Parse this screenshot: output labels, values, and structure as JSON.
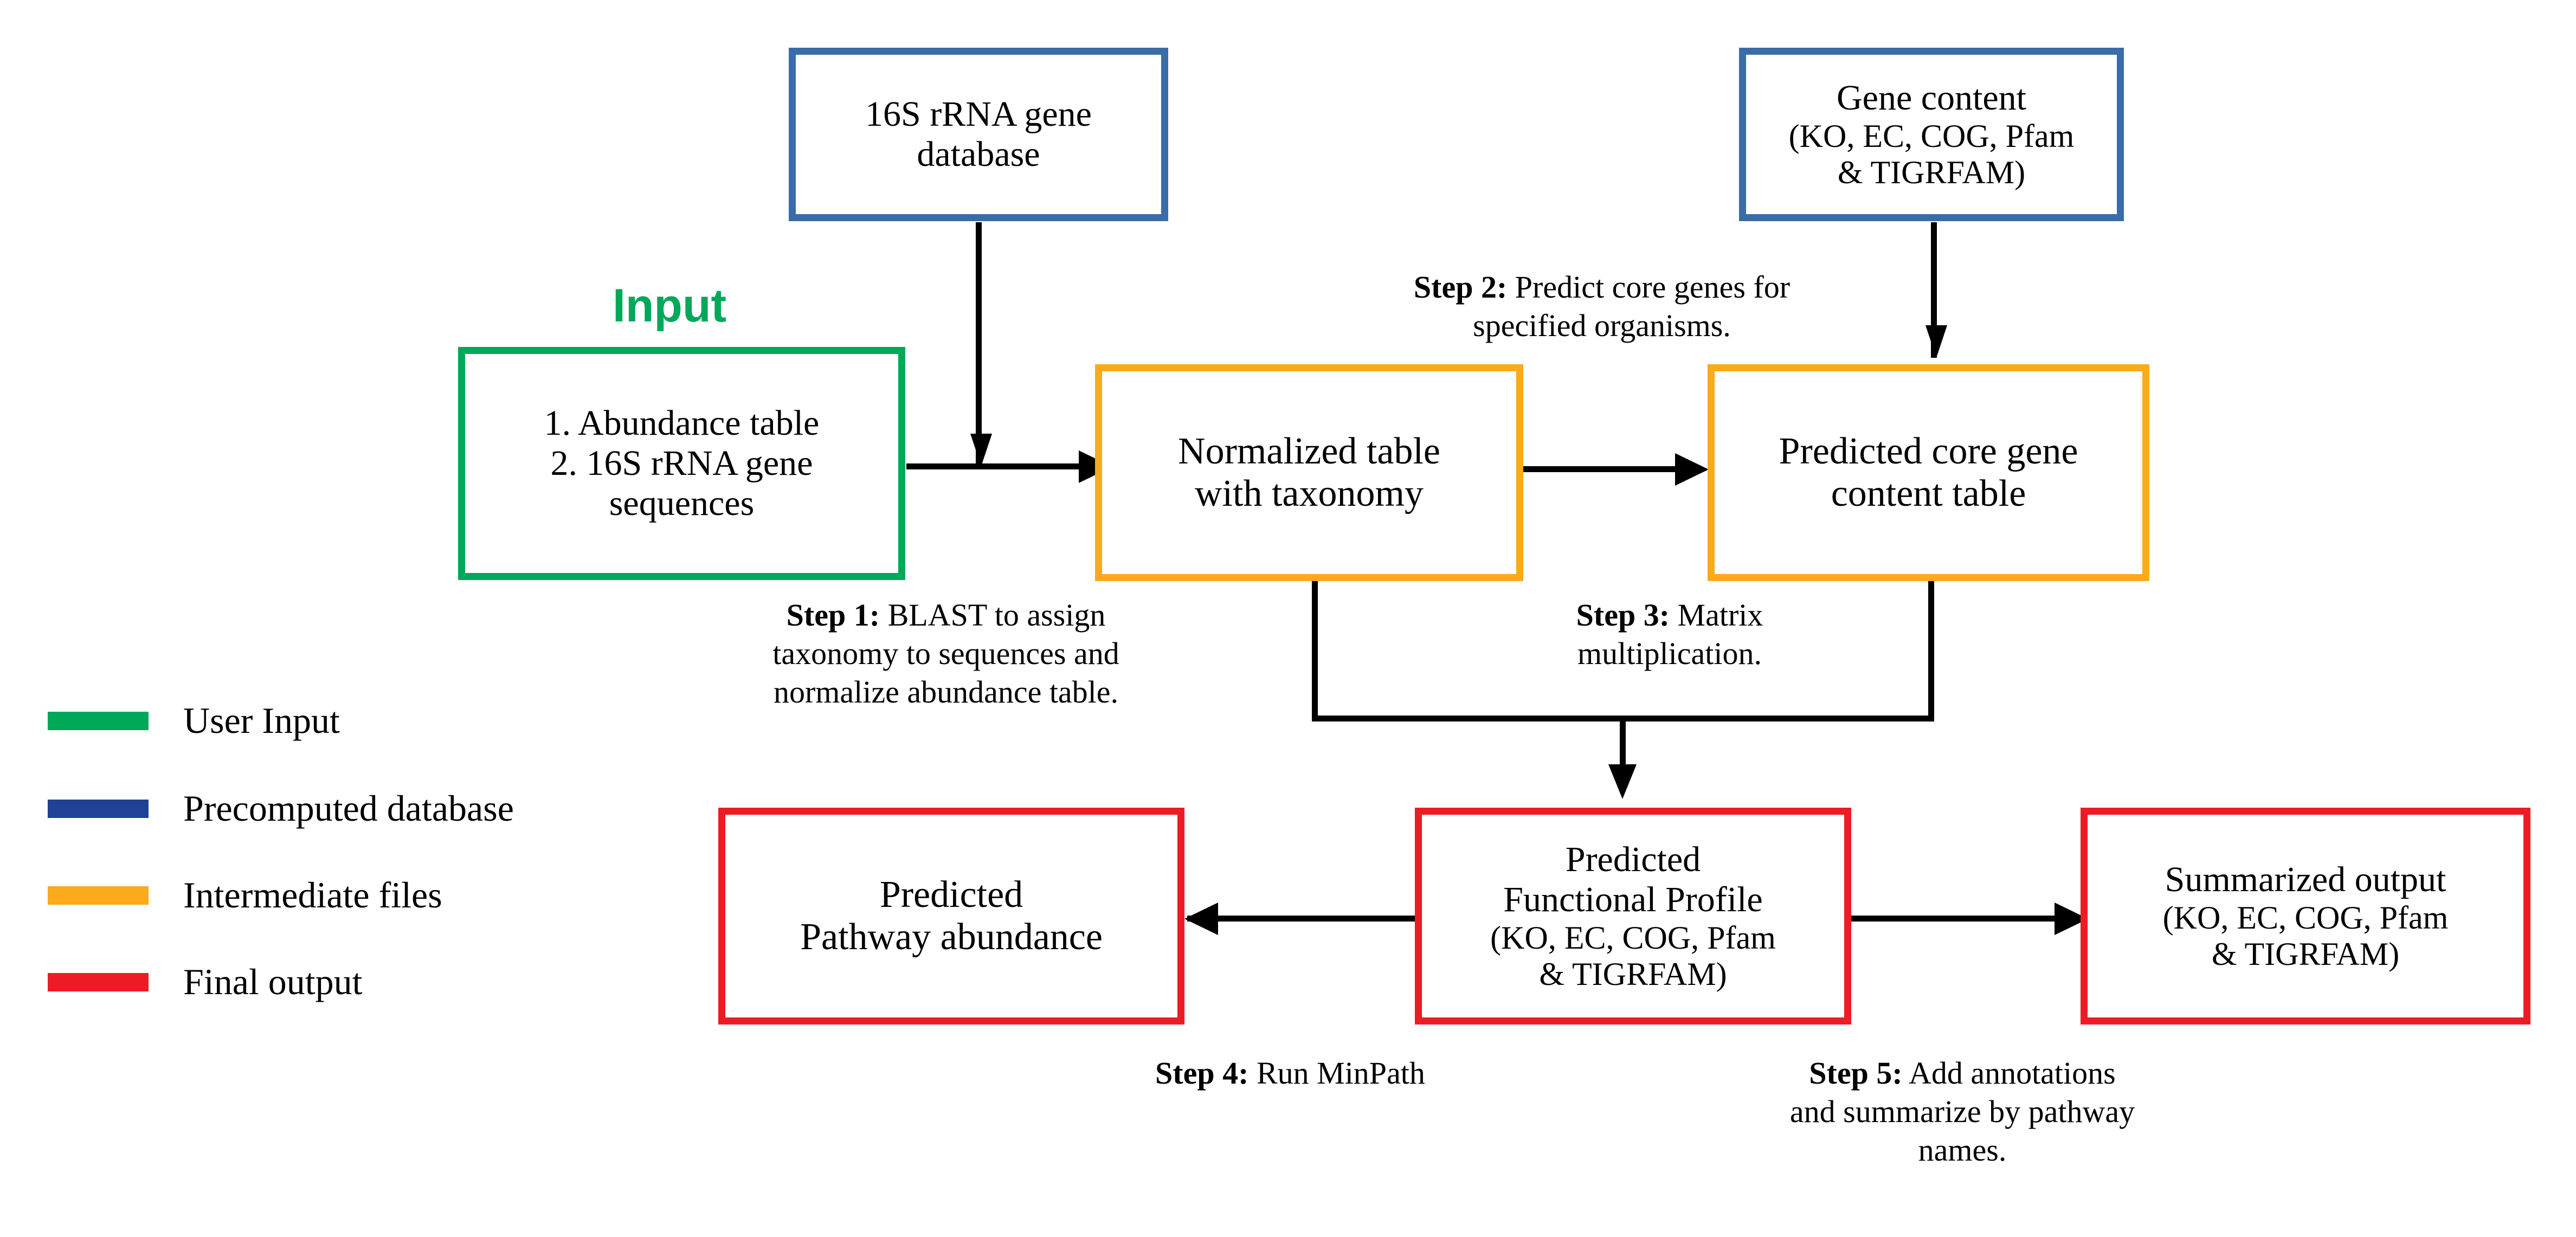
{
  "diagram": {
    "title_label": "Input",
    "nodes": {
      "rrna_db": {
        "line1": "16S rRNA gene",
        "line2": "database"
      },
      "gene_content": {
        "line1": "Gene content",
        "line2": "(KO, EC, COG, Pfam",
        "line3": "& TIGRFAM)"
      },
      "user_input": {
        "line1": "1. Abundance table",
        "line2": "2. 16S rRNA gene",
        "line3": "sequences"
      },
      "normalized_table": {
        "line1": "Normalized table",
        "line2": "with taxonomy"
      },
      "core_gene_table": {
        "line1": "Predicted core gene",
        "line2": "content table"
      },
      "pathway_abundance": {
        "line1": "Predicted",
        "line2": "Pathway abundance"
      },
      "functional_profile": {
        "line1": "Predicted",
        "line2": "Functional Profile",
        "line3": "(KO, EC, COG, Pfam",
        "line4": "& TIGRFAM)"
      },
      "summarized_output": {
        "line1": "Summarized output",
        "line2": "(KO, EC, COG, Pfam",
        "line3": "& TIGRFAM)"
      }
    },
    "steps": {
      "step1": {
        "label": "Step 1:",
        "line1": " BLAST to assign",
        "line2": "taxonomy to sequences and",
        "line3": "normalize abundance table."
      },
      "step2": {
        "label": "Step 2:",
        "line1": " Predict core genes for",
        "line2": "specified organisms."
      },
      "step3": {
        "label": "Step 3:",
        "line1": " Matrix",
        "line2": "multiplication."
      },
      "step4": {
        "label": "Step 4:",
        "line1": " Run MinPath"
      },
      "step5": {
        "label": "Step 5:",
        "line1": " Add annotations",
        "line2": "and summarize by pathway",
        "line3": "names."
      }
    },
    "legend": {
      "items": [
        {
          "label": "User Input",
          "color": "#00A859"
        },
        {
          "label": "Precomputed database",
          "color": "#1F4296"
        },
        {
          "label": "Intermediate files",
          "color": "#FAAA1A"
        },
        {
          "label": "Final output",
          "color": "#ED1C24"
        }
      ]
    },
    "colors": {
      "user_input": "#00A859",
      "precomputed_database_box": "#3A6CA8",
      "precomputed_database_legend": "#1F4296",
      "intermediate_files": "#FAAA1A",
      "final_output": "#ED1C24",
      "connector": "#000000",
      "background": "#FFFFFF"
    }
  }
}
